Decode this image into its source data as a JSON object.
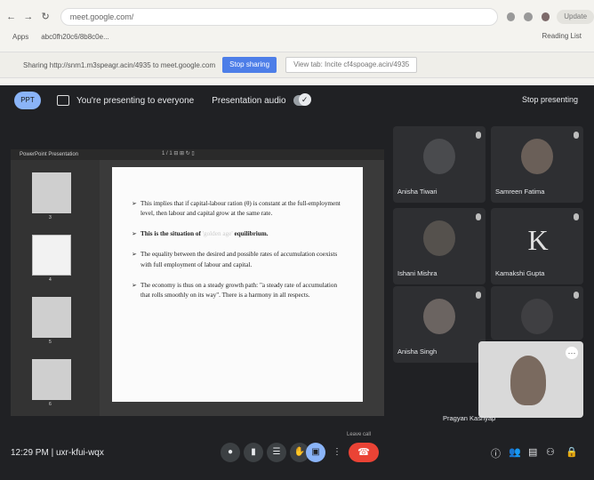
{
  "browser": {
    "address": "meet.google.com/",
    "bookmarks": [
      "Apps",
      "abc0fh20c6/8b8c0e..."
    ],
    "reading_list": "Reading List",
    "profile_label": "Update"
  },
  "share_bar": {
    "text": "Sharing http://snm1.m3speagr.acin/4935 to meet.google.com",
    "stop_label": "Stop sharing",
    "switch_label": "View tab: Incite cf4spoage.acin/4935"
  },
  "meet": {
    "pip_label": "PPT",
    "presenting_text": "You're presenting to everyone",
    "audio_text": "Presentation audio",
    "stop_presenting": "Stop presenting",
    "time": "12:29 PM",
    "meeting_code": "uxr-kfui-wqx",
    "tooltip": "Leave call",
    "end_call_icon": "phone-hangup-icon"
  },
  "ppt": {
    "title": "PowerPoint Presentation",
    "toolbar": "1 / 1   ⊟  ⊞  ↻  ▯",
    "slide_numbers": [
      "3",
      "4",
      "5",
      "6"
    ],
    "bullets": [
      {
        "text": "This implies that if capital-labour ration (θ) is constant at the full-employment level, then labour and capital grow at the same rate."
      },
      {
        "bold_prefix": "This is the situation of ",
        "faint": "'golden age'",
        "bold_suffix": " equilibrium."
      },
      {
        "text": "The equality between the desired and possible rates of accumulation coexists with full employment of labour and capital."
      },
      {
        "text": "The economy is thus on a steady growth path: \"a steady rate of accumulation that rolls smoothly on its way\". There is a harmony in all respects."
      }
    ]
  },
  "participants": [
    {
      "name": "Anisha Tiwari"
    },
    {
      "name": "Samreen Fatima"
    },
    {
      "name": "Ishani Mishra"
    },
    {
      "name": "Kamakshi Gupta",
      "initial": "K"
    },
    {
      "name": "Anisha Singh"
    },
    {
      "name": "Pragyan Kashyap"
    }
  ],
  "self_view": {
    "name": "Pragyan Kashyap"
  }
}
